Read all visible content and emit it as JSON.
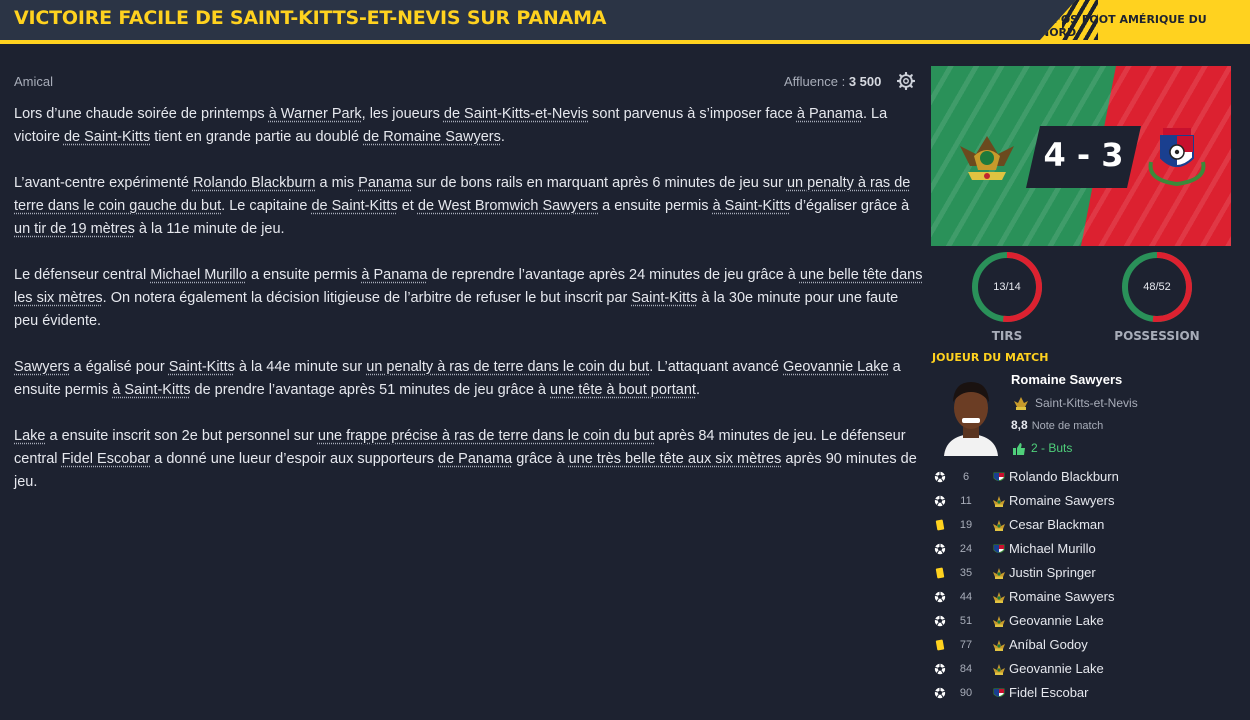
{
  "header": {
    "title": "VICTOIRE FACILE DE SAINT-KITTS-ET-NEVIS SUR PANAMA",
    "badge": "INFOS FOOT AMÉRIQUE DU NORD"
  },
  "meta": {
    "competition": "Amical",
    "attendance_label": "Affluence :",
    "attendance_value": "3 500"
  },
  "article": {
    "p1": [
      {
        "t": "Lors d’une chaude soirée de printemps "
      },
      {
        "t": "à Warner Park",
        "u": true
      },
      {
        "t": ", les joueurs "
      },
      {
        "t": "de Saint-Kitts-et-Nevis",
        "u": true
      },
      {
        "t": " sont parvenus à s’imposer face "
      },
      {
        "t": "à Panama",
        "u": true
      },
      {
        "t": ". La victoire "
      },
      {
        "t": "de Saint-Kitts",
        "u": true
      },
      {
        "t": " tient en grande partie au doublé "
      },
      {
        "t": "de Romaine Sawyers",
        "u": true
      },
      {
        "t": "."
      }
    ],
    "p2": [
      {
        "t": "L’avant-centre expérimenté "
      },
      {
        "t": "Rolando Blackburn",
        "u": true
      },
      {
        "t": " a mis "
      },
      {
        "t": "Panama",
        "u": true
      },
      {
        "t": " sur de bons rails en marquant après 6 minutes de jeu sur "
      },
      {
        "t": "un penalty à ras de terre dans le coin gauche du but",
        "u": true
      },
      {
        "t": ". Le capitaine "
      },
      {
        "t": "de Saint-Kitts",
        "u": true
      },
      {
        "t": " et "
      },
      {
        "t": "de West Bromwich Sawyers",
        "u": true
      },
      {
        "t": " a ensuite permis "
      },
      {
        "t": "à Saint-Kitts",
        "u": true
      },
      {
        "t": " d’égaliser grâce à "
      },
      {
        "t": "un tir de 19 mètres",
        "u": true
      },
      {
        "t": " à la 11e minute de jeu."
      }
    ],
    "p3": [
      {
        "t": "Le défenseur central "
      },
      {
        "t": "Michael Murillo",
        "u": true
      },
      {
        "t": " a ensuite permis "
      },
      {
        "t": "à Panama",
        "u": true
      },
      {
        "t": " de reprendre l’avantage après 24 minutes de jeu grâce à "
      },
      {
        "t": "une belle tête dans les six mètres",
        "u": true
      },
      {
        "t": ". On notera également la décision litigieuse de l’arbitre de refuser le but inscrit par "
      },
      {
        "t": "Saint-Kitts",
        "u": true
      },
      {
        "t": " à la 30e minute pour une faute peu évidente."
      }
    ],
    "p4": [
      {
        "t": "Sawyers",
        "u": true
      },
      {
        "t": " a égalisé pour "
      },
      {
        "t": "Saint-Kitts",
        "u": true
      },
      {
        "t": " à la 44e minute sur "
      },
      {
        "t": "un penalty à ras de terre dans le coin du but",
        "u": true
      },
      {
        "t": ". L’attaquant avancé "
      },
      {
        "t": "Geovannie Lake",
        "u": true
      },
      {
        "t": " a ensuite permis "
      },
      {
        "t": "à Saint-Kitts",
        "u": true
      },
      {
        "t": " de prendre l’avantage après 51 minutes de jeu grâce à "
      },
      {
        "t": "une tête à bout portant",
        "u": true
      },
      {
        "t": "."
      }
    ],
    "p5": [
      {
        "t": "Lake",
        "u": true
      },
      {
        "t": " a ensuite inscrit son 2e but personnel sur "
      },
      {
        "t": "une frappe précise à ras de terre dans le coin du but",
        "u": true
      },
      {
        "t": " après 84 minutes de jeu. Le défenseur central "
      },
      {
        "t": "Fidel Escobar",
        "u": true
      },
      {
        "t": " a donné une lueur d’espoir aux supporteurs "
      },
      {
        "t": "de Panama",
        "u": true
      },
      {
        "t": " grâce à "
      },
      {
        "t": "une très belle tête aux six mètres",
        "u": true
      },
      {
        "t": " après 90 minutes de jeu."
      }
    ]
  },
  "match": {
    "score": "4 - 3",
    "home_goals": 4,
    "away_goals": 3,
    "colors": {
      "home": "#2a9159",
      "away": "#dc2130",
      "accent": "#ffd21f"
    }
  },
  "stats": {
    "shots": {
      "label": "TIRS",
      "value": "13/14",
      "home": 13,
      "away": 14
    },
    "possession": {
      "label": "POSSESSION",
      "value": "48/52",
      "home": 48,
      "away": 52
    }
  },
  "potm": {
    "title": "JOUEUR DU MATCH",
    "name": "Romaine Sawyers",
    "team": "Saint-Kitts-et-Nevis",
    "rating": "8,8",
    "rating_label": "Note de match",
    "goals": "2 - Buts"
  },
  "events": [
    {
      "type": "goal",
      "minute": "6",
      "team": "panama",
      "player": "Rolando Blackburn"
    },
    {
      "type": "goal",
      "minute": "11",
      "team": "skn",
      "player": "Romaine Sawyers"
    },
    {
      "type": "yellow",
      "minute": "19",
      "team": "skn",
      "player": "Cesar Blackman"
    },
    {
      "type": "goal",
      "minute": "24",
      "team": "panama",
      "player": "Michael Murillo"
    },
    {
      "type": "yellow",
      "minute": "35",
      "team": "skn",
      "player": "Justin Springer"
    },
    {
      "type": "goal",
      "minute": "44",
      "team": "skn",
      "player": "Romaine Sawyers"
    },
    {
      "type": "goal",
      "minute": "51",
      "team": "skn",
      "player": "Geovannie Lake"
    },
    {
      "type": "yellow",
      "minute": "77",
      "team": "skn",
      "player": "Aníbal Godoy"
    },
    {
      "type": "goal",
      "minute": "84",
      "team": "skn",
      "player": "Geovannie Lake"
    },
    {
      "type": "goal",
      "minute": "90",
      "team": "panama",
      "player": "Fidel Escobar"
    }
  ]
}
